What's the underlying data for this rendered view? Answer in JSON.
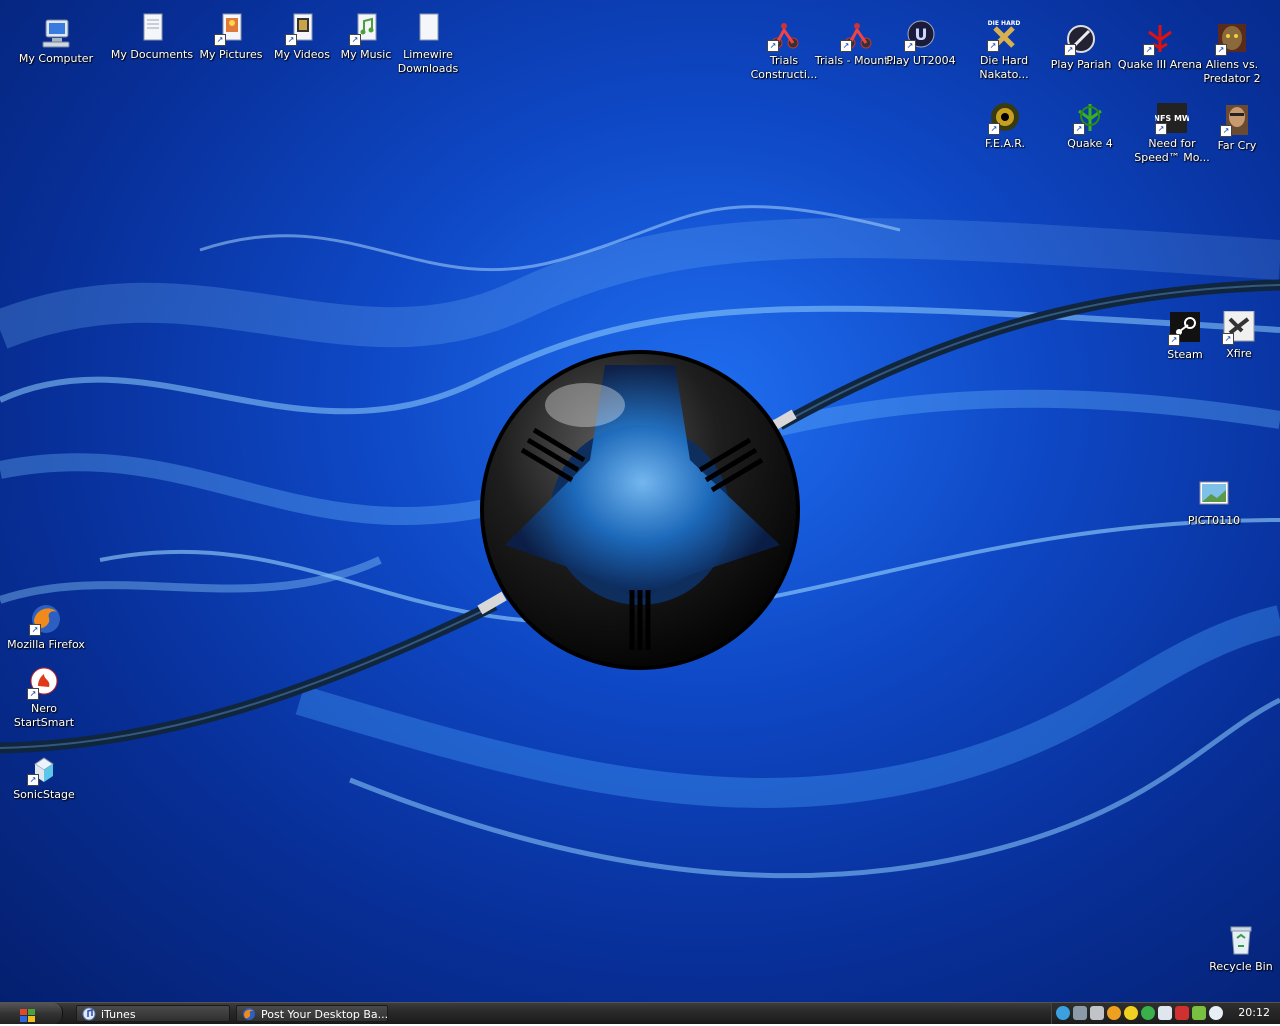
{
  "desktop": {
    "left_icons": [
      {
        "label": "My Computer",
        "icon": "computer-icon"
      },
      {
        "label": "My Documents",
        "icon": "folder-documents-icon"
      },
      {
        "label": "My Pictures",
        "icon": "folder-pictures-icon"
      },
      {
        "label": "My Videos",
        "icon": "folder-videos-icon"
      },
      {
        "label": "My Music",
        "icon": "folder-music-icon"
      },
      {
        "label": "Limewire Downloads",
        "icon": "folder-icon"
      }
    ],
    "side_icons": [
      {
        "label": "Mozilla Firefox",
        "icon": "firefox-icon"
      },
      {
        "label": "Nero StartSmart",
        "icon": "nero-icon"
      },
      {
        "label": "SonicStage",
        "icon": "sonicstage-icon"
      }
    ],
    "game_icons_row1": [
      {
        "label": "Trials Constructi...",
        "icon": "trials-icon"
      },
      {
        "label": "Trials - Mount...",
        "icon": "trials-icon"
      },
      {
        "label": "Play UT2004",
        "icon": "ut2004-icon"
      },
      {
        "label": "Die Hard Nakato...",
        "icon": "die-hard-icon",
        "badge": "DIE HARD"
      },
      {
        "label": "Play Pariah",
        "icon": "pariah-icon"
      },
      {
        "label": "Quake III Arena",
        "icon": "quake3-icon"
      },
      {
        "label": "Aliens vs. Predator 2",
        "icon": "avp2-icon"
      }
    ],
    "game_icons_row2": [
      {
        "label": "F.E.A.R.",
        "icon": "fear-icon"
      },
      {
        "label": "Quake 4",
        "icon": "quake4-icon"
      },
      {
        "label": "Need for Speed™ Mo...",
        "icon": "nfs-icon",
        "badge": "NFS MW"
      },
      {
        "label": "Far Cry",
        "icon": "farcry-icon"
      }
    ],
    "right_icons": [
      {
        "label": "Steam",
        "icon": "steam-icon"
      },
      {
        "label": "Xfire",
        "icon": "xfire-icon"
      },
      {
        "label": "PICT0110",
        "icon": "image-file-icon"
      },
      {
        "label": "Recycle Bin",
        "icon": "recycle-bin-icon"
      }
    ]
  },
  "taskbar": {
    "tasks": [
      {
        "label": "iTunes",
        "icon": "itunes-icon"
      },
      {
        "label": "Post Your Desktop Ba...",
        "icon": "firefox-icon"
      }
    ],
    "tray_icons": [
      "skype-icon",
      "network-icon",
      "usb-icon",
      "vlc-icon",
      "msn-icon",
      "globe-icon",
      "security-icon",
      "xfire-tray-icon",
      "battery-icon",
      "volume-icon"
    ],
    "clock": "20:12"
  }
}
